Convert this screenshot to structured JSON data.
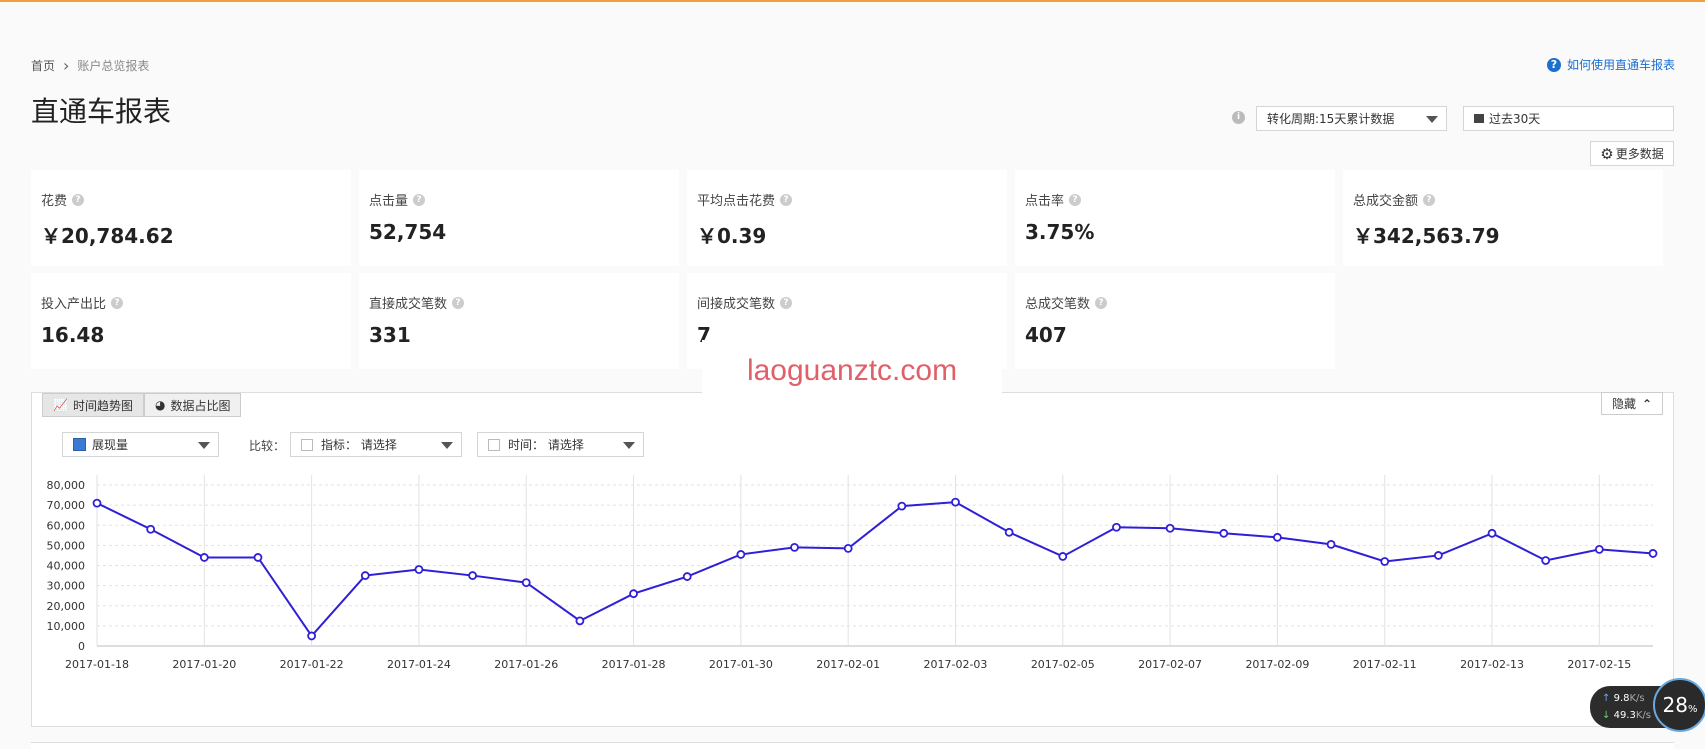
{
  "breadcrumb": {
    "home": "首页",
    "current": "账户总览报表"
  },
  "help_link": "如何使用直通车报表",
  "page_title": "直通车报表",
  "controls": {
    "period": "转化周期:15天累计数据",
    "date_range": "过去30天",
    "more_data": "更多数据"
  },
  "metrics": [
    {
      "label": "花费",
      "value": "￥20,784.62"
    },
    {
      "label": "点击量",
      "value": "52,754"
    },
    {
      "label": "平均点击花费",
      "value": "￥0.39"
    },
    {
      "label": "点击率",
      "value": "3.75%"
    },
    {
      "label": "总成交金额",
      "value": "￥342,563.79"
    },
    {
      "label": "投入产出比",
      "value": "16.48"
    },
    {
      "label": "直接成交笔数",
      "value": "331"
    },
    {
      "label": "间接成交笔数",
      "value": "7"
    },
    {
      "label": "总成交笔数",
      "value": "407"
    }
  ],
  "watermark": "laoguanztc.com",
  "chart_panel": {
    "tab_trend": "时间趋势图",
    "tab_share": "数据占比图",
    "hide": "隐藏",
    "metric_select": "展现量",
    "compare_label": "比较：",
    "compare_metric": "指标： 请选择",
    "compare_time": "时间： 请选择"
  },
  "colors": {
    "series": "#2f1fd6",
    "accent": "#1a6fd0",
    "watermark": "#e0606a"
  },
  "chart_data": {
    "type": "line",
    "x": [
      "2017-01-18",
      "2017-01-19",
      "2017-01-20",
      "2017-01-21",
      "2017-01-22",
      "2017-01-23",
      "2017-01-24",
      "2017-01-25",
      "2017-01-26",
      "2017-01-27",
      "2017-01-28",
      "2017-01-29",
      "2017-01-30",
      "2017-01-31",
      "2017-02-01",
      "2017-02-02",
      "2017-02-03",
      "2017-02-04",
      "2017-02-05",
      "2017-02-06",
      "2017-02-07",
      "2017-02-08",
      "2017-02-09",
      "2017-02-10",
      "2017-02-11",
      "2017-02-12",
      "2017-02-13",
      "2017-02-14",
      "2017-02-15",
      "2017-02-16"
    ],
    "x_tick_labels": [
      "2017-01-18",
      "2017-01-20",
      "2017-01-22",
      "2017-01-24",
      "2017-01-26",
      "2017-01-28",
      "2017-01-30",
      "2017-02-01",
      "2017-02-03",
      "2017-02-05",
      "2017-02-07",
      "2017-02-09",
      "2017-02-11",
      "2017-02-13",
      "2017-02-15"
    ],
    "series": [
      {
        "values": [
          71000,
          58000,
          44000,
          44000,
          5000,
          35000,
          38000,
          35000,
          31500,
          12500,
          26000,
          34500,
          45500,
          49000,
          48500,
          69500,
          71500,
          56500,
          44500,
          59000,
          58500,
          56000,
          54000,
          50500,
          42000,
          45000,
          56000,
          42500,
          48000,
          46000
        ]
      }
    ],
    "yticks": [
      0,
      10000,
      20000,
      30000,
      40000,
      50000,
      60000,
      70000,
      80000
    ],
    "ytick_labels": [
      "0",
      "10,000",
      "20,000",
      "30,000",
      "40,000",
      "50,000",
      "60,000",
      "70,000",
      "80,000"
    ],
    "ylim": [
      0,
      80000
    ],
    "grid": true,
    "legend": "none"
  },
  "speed_widget": {
    "up": "9.8",
    "down": "49.3",
    "unit": "K/s",
    "percent": "28",
    "percent_unit": "%"
  }
}
